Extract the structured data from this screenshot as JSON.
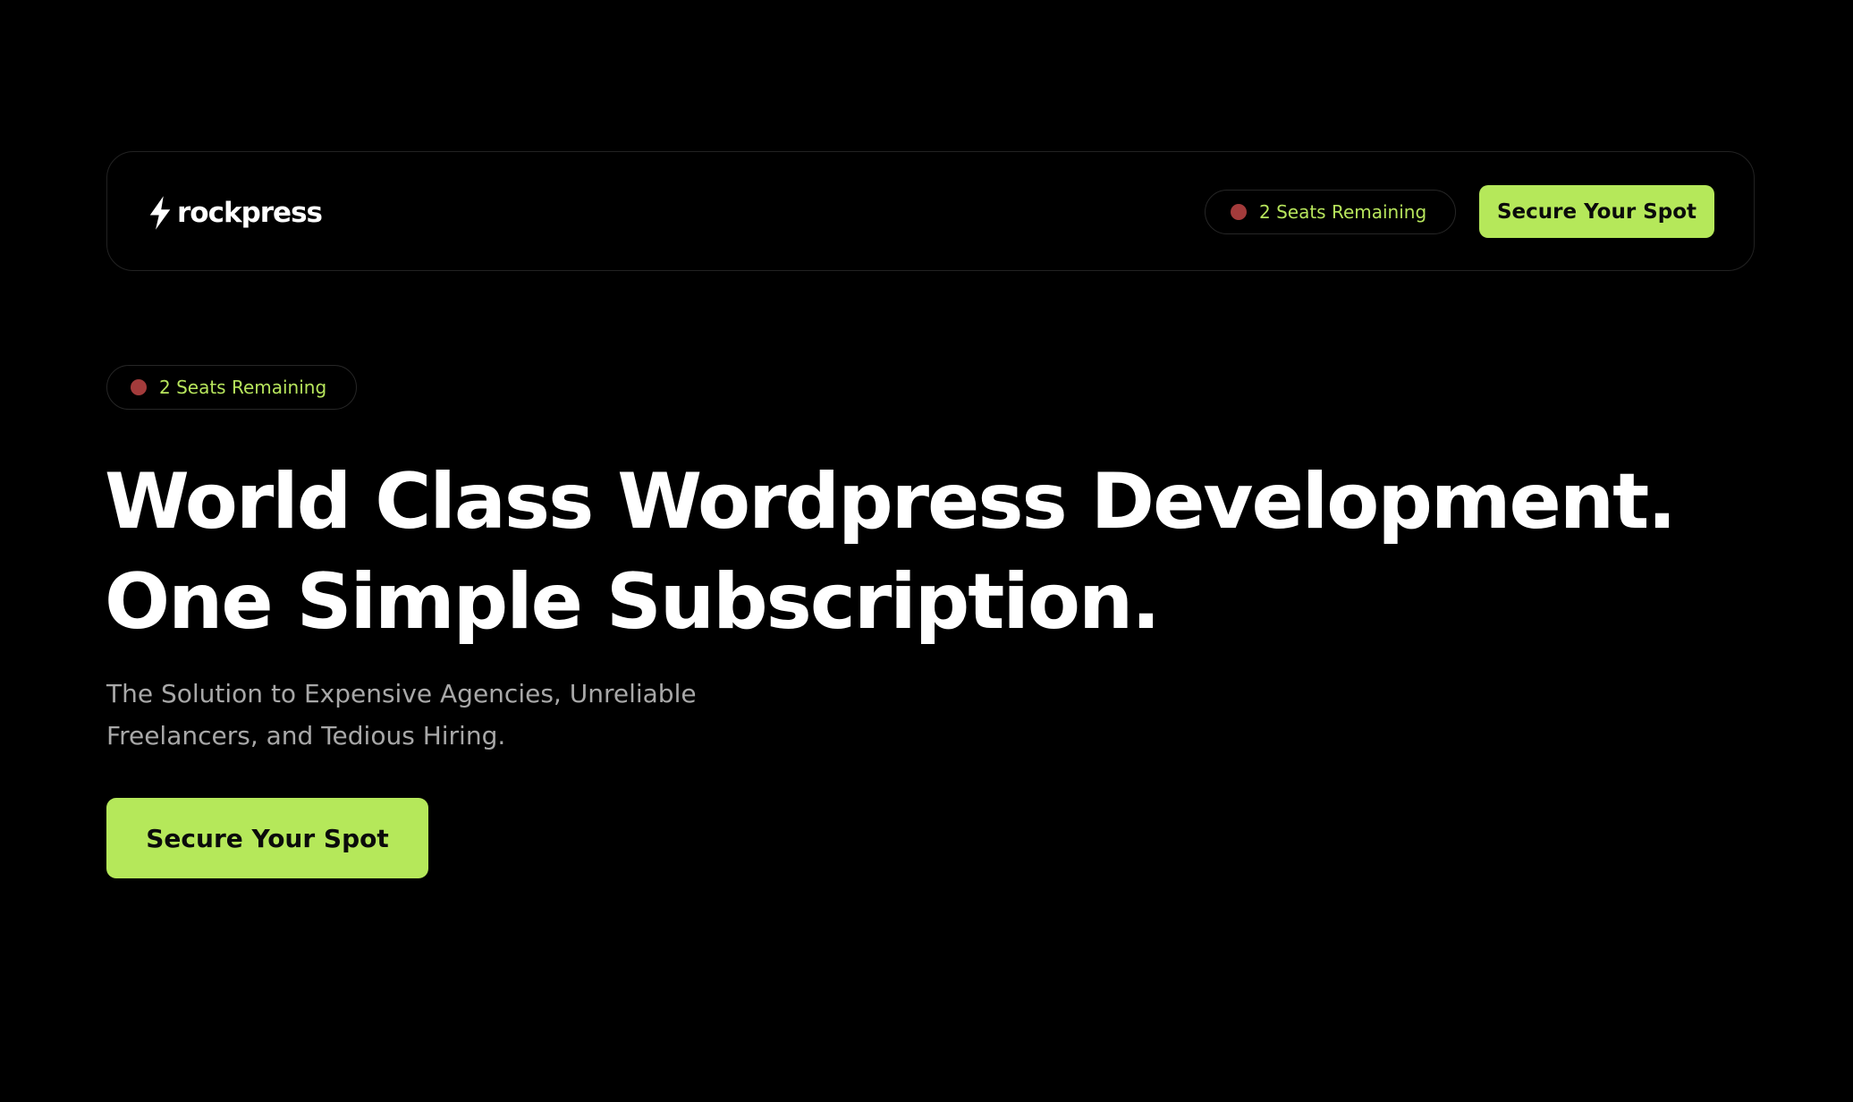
{
  "brand": {
    "name": "rockpress",
    "icon": "lightning-bolt-icon"
  },
  "nav": {
    "seats_badge": "2 Seats Remaining",
    "cta_label": "Secure Your Spot"
  },
  "hero": {
    "seats_badge": "2 Seats Remaining",
    "title_line_1": "World Class Wordpress Development.",
    "title_line_2": "One Simple Subscription.",
    "subtitle_line_1": "The Solution to Expensive Agencies, Unreliable",
    "subtitle_line_2": "Freelancers, and Tedious Hiring.",
    "cta_label": "Secure Your Spot"
  },
  "colors": {
    "background": "#000000",
    "accent": "#b5e85a",
    "badge_text": "#b7e55c",
    "status_dot": "#a33b3b",
    "subtitle": "#a8a8a8"
  }
}
